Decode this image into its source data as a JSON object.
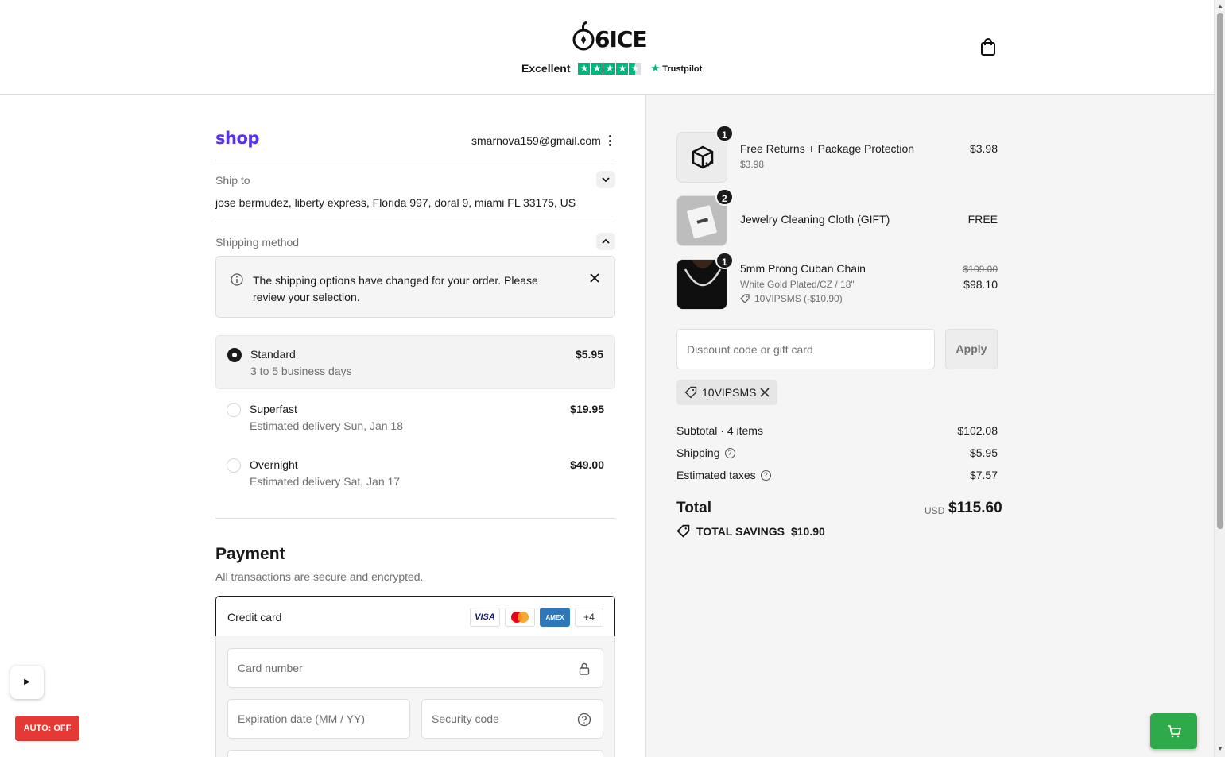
{
  "header": {
    "brand": "6ICE",
    "trust_rating_label": "Excellent",
    "trust_brand": "Trustpilot",
    "trust_stars": 4.5,
    "trust_color": "#00b67a"
  },
  "account": {
    "shop_logo": "shop",
    "shop_color": "#5a31f4",
    "email": "smarnova159@gmail.com"
  },
  "ship_to": {
    "label": "Ship to",
    "address": "jose bermudez, liberty express, Florida 997, doral 9, miami FL 33175, US"
  },
  "shipping": {
    "label": "Shipping method",
    "notice": "The shipping options have changed for your order. Please review your selection.",
    "options": [
      {
        "name": "Standard",
        "sub": "3 to 5 business days",
        "price": "$5.95",
        "selected": true
      },
      {
        "name": "Superfast",
        "sub": "Estimated delivery Sun, Jan 18",
        "price": "$19.95",
        "selected": false
      },
      {
        "name": "Overnight",
        "sub": "Estimated delivery Sat, Jan 17",
        "price": "$49.00",
        "selected": false
      }
    ]
  },
  "payment": {
    "title": "Payment",
    "subtitle": "All transactions are secure and encrypted.",
    "method": "Credit card",
    "badges": [
      "VISA",
      "Mastercard",
      "AMEX",
      "+4"
    ],
    "card_number_ph": "Card number",
    "expiry_ph": "Expiration date (MM / YY)",
    "cvc_ph": "Security code"
  },
  "cart": {
    "items": [
      {
        "qty": "1",
        "name": "Free Returns + Package Protection",
        "sub": "$3.98",
        "price": "$3.98",
        "thumb_icon": "package-check-icon"
      },
      {
        "qty": "2",
        "name": "Jewelry Cleaning Cloth (GIFT)",
        "price": "FREE",
        "thumb_icon": "cleaning-cloth-image"
      },
      {
        "qty": "1",
        "name": "5mm Prong Cuban Chain",
        "sub": "White Gold Plated/CZ / 18\"",
        "discount": "10VIPSMS (-$10.90)",
        "old_price": "$109.00",
        "price": "$98.10",
        "thumb_icon": "chain-model-image"
      }
    ],
    "discount_ph": "Discount code or gift card",
    "apply_label": "Apply",
    "applied_code": "10VIPSMS"
  },
  "summary": {
    "subtotal_label": "Subtotal · 4 items",
    "subtotal": "$102.08",
    "shipping_label": "Shipping",
    "shipping": "$5.95",
    "taxes_label": "Estimated taxes",
    "taxes": "$7.57",
    "total_label": "Total",
    "currency": "USD",
    "total": "$115.60",
    "savings_label": "TOTAL SAVINGS",
    "savings": "$10.90"
  },
  "widgets": {
    "auto_label": "AUTO: OFF",
    "auto_color": "#e53935",
    "cart_fab_color": "#2eaa4a"
  }
}
